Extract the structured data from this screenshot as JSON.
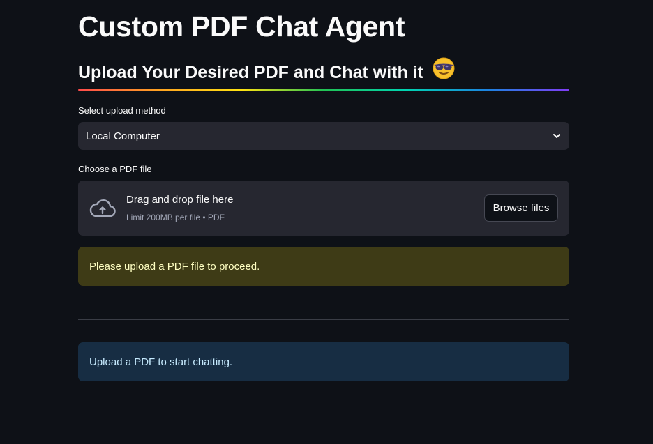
{
  "app": {
    "title": "Custom PDF Chat Agent",
    "subheader": "Upload Your Desired PDF and Chat with it",
    "subheader_icon": "smiling-face-with-sunglasses-emoji"
  },
  "upload_method": {
    "label": "Select upload method",
    "selected": "Local Computer",
    "icon": "chevron-down-icon"
  },
  "file_uploader": {
    "label": "Choose a PDF file",
    "drop_text": "Drag and drop file here",
    "limit_text": "Limit 200MB per file • PDF",
    "browse_label": "Browse files",
    "icon": "cloud-upload-icon"
  },
  "alerts": {
    "warning": "Please upload a PDF file to proceed.",
    "info": "Upload a PDF to start chatting."
  },
  "colors": {
    "background": "#0e1117",
    "widget": "#262730",
    "warning_bg": "#3e3b16",
    "warning_text": "#ffffc2",
    "info_bg": "#172d43",
    "info_text": "#c7ebff"
  }
}
